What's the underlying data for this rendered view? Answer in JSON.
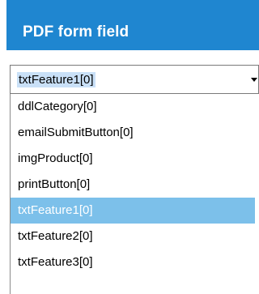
{
  "header": {
    "title": "PDF form field"
  },
  "combo": {
    "selected_value": "txtFeature1[0]",
    "arrow_icon": "chevron-down-icon"
  },
  "dropdown": {
    "items": [
      {
        "label": "ddlCategory[0]",
        "selected": false
      },
      {
        "label": "emailSubmitButton[0]",
        "selected": false
      },
      {
        "label": "imgProduct[0]",
        "selected": false
      },
      {
        "label": "printButton[0]",
        "selected": false
      },
      {
        "label": "txtFeature1[0]",
        "selected": true
      },
      {
        "label": "txtFeature2[0]",
        "selected": false
      },
      {
        "label": "txtFeature3[0]",
        "selected": false
      }
    ]
  },
  "colors": {
    "header_bg": "#1f86d0",
    "selected_item_bg": "#7cc0ea",
    "combo_value_highlight": "#c9e0f7"
  }
}
